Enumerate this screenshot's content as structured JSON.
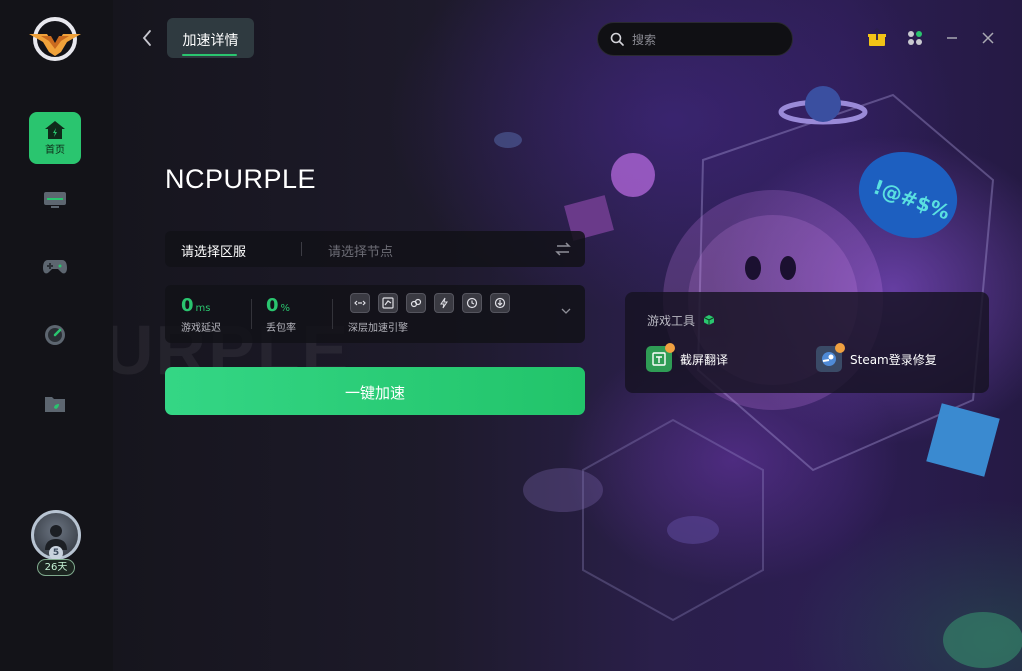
{
  "header": {
    "tab_label": "加速详情",
    "search_placeholder": "搜索"
  },
  "sidebar": {
    "items": [
      {
        "name": "home",
        "label": "首页"
      },
      {
        "name": "monitor",
        "label": ""
      },
      {
        "name": "games",
        "label": ""
      },
      {
        "name": "speed",
        "label": ""
      },
      {
        "name": "folder",
        "label": ""
      }
    ],
    "level": "5",
    "days": "26天"
  },
  "game": {
    "title": "NCPURPLE",
    "bg_text": "URPLE"
  },
  "selector": {
    "region_label": "请选择区服",
    "node_placeholder": "请选择节点"
  },
  "stats": {
    "latency_value": "0",
    "latency_unit": "ms",
    "latency_label": "游戏延迟",
    "loss_value": "0",
    "loss_unit": "%",
    "loss_label": "丢包率",
    "engine_label": "深层加速引擎"
  },
  "accelerate_button": "一键加速",
  "tools": {
    "title": "游戏工具",
    "items": [
      {
        "name": "截屏翻译",
        "icon": "screenshot-translate-icon"
      },
      {
        "name": "Steam登录修复",
        "icon": "steam-icon"
      }
    ]
  },
  "colors": {
    "accent": "#2ac56f",
    "sidebar_bg": "#131318",
    "panel_bg": "#121218"
  }
}
